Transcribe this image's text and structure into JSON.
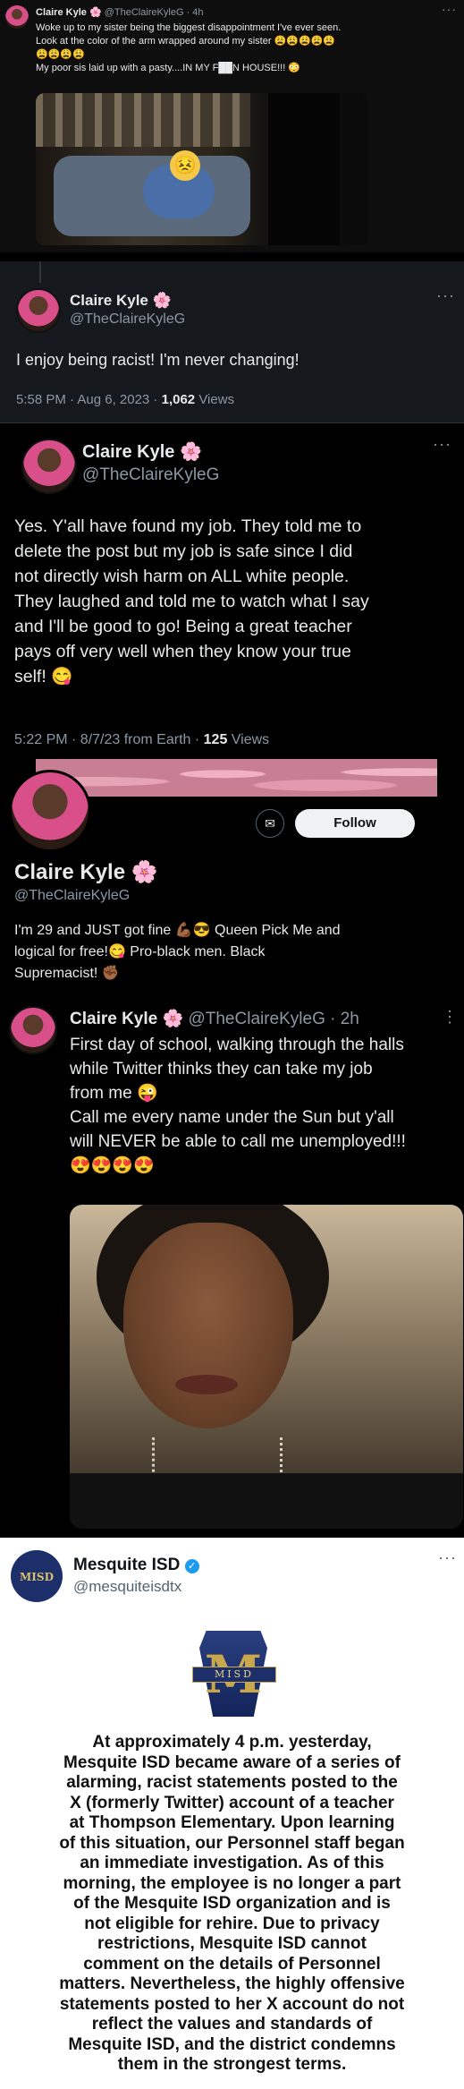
{
  "tweet1": {
    "name": "Claire Kyle",
    "flower": "🌸",
    "handle": "@TheClaireKyleG",
    "time": "· 4h",
    "more": "···",
    "line1": "Woke up to my sister being the biggest disappointment I've ever seen.",
    "line2": "Look at the color of the arm wrapped around my sister 😩😩😩😩😩",
    "line3": "😩😩😩😩",
    "line4": "My poor sis laid up with a pasty....IN MY F██N HOUSE!!! 😳"
  },
  "tweet2": {
    "name": "Claire Kyle",
    "flower": "🌸",
    "handle": "@TheClaireKyleG",
    "more": "···",
    "text": "I enjoy being racist! I'm never changing!",
    "meta_prefix": "5:58 PM · Aug 6, 2023 · ",
    "views_count": "1,062",
    "views_label": " Views"
  },
  "tweet3": {
    "name": "Claire Kyle",
    "flower": "🌸",
    "handle": "@TheClaireKyleG",
    "more": "···",
    "lines": [
      "Yes. Y'all have found my job. They told me to",
      "delete the post but my job is safe since I did",
      "not directly wish harm on ALL white people.",
      "They laughed and told me to watch what I say",
      "and I'll be good to go! Being a great teacher",
      "pays off very well when they know your true",
      "self! 😋"
    ],
    "meta_prefix": "5:22 PM · 8/7/23 from Earth · ",
    "views_count": "125",
    "views_label": " Views"
  },
  "profile": {
    "name": "Claire Kyle",
    "flower": "🌸",
    "handle": "@TheClaireKyleG",
    "follow_label": "Follow",
    "bio_line1": "I'm 29 and JUST got fine 💪🏾😎 Queen Pick Me and",
    "bio_line2": "logical for free!😋 Pro-black men. Black",
    "bio_line3": "Supremacist! ✊🏾"
  },
  "tweet4": {
    "name": "Claire Kyle",
    "flower": "🌸",
    "handle": "@TheClaireKyleG · 2h",
    "more": "⋮",
    "lines": [
      "First day of school, walking through the halls",
      "while Twitter thinks they can take my job",
      "from me 😜",
      "Call me every name under the Sun but y'all",
      "will NEVER be able to call me unemployed!!!",
      "😍😍😍😍"
    ]
  },
  "district": {
    "name": "Mesquite ISD",
    "handle": "@mesquiteisdtx",
    "more": "···",
    "logo_text": "MISD",
    "statement": [
      "At approximately 4 p.m. yesterday,",
      "Mesquite ISD became aware of a series of",
      "alarming, racist statements posted to the",
      "X (formerly Twitter) account of a teacher",
      "at Thompson Elementary. Upon learning",
      "of this situation, our Personnel staff began",
      "an immediate investigation. As of this",
      "morning, the employee is no longer a part",
      "of the Mesquite ISD organization and is",
      "not eligible for rehire. Due to privacy",
      "restrictions, Mesquite ISD cannot",
      "comment on the details of Personnel",
      "matters. Nevertheless, the highly offensive",
      "statements posted to her X account do not",
      "reflect the values and standards of",
      "Mesquite ISD, and the district condemns",
      "them in the strongest terms."
    ]
  },
  "colors": {
    "background": "#000000",
    "text": "#e7e9ea",
    "muted": "#8b98a5",
    "verified": "#1d9bf0",
    "district_bg": "#ffffff"
  }
}
